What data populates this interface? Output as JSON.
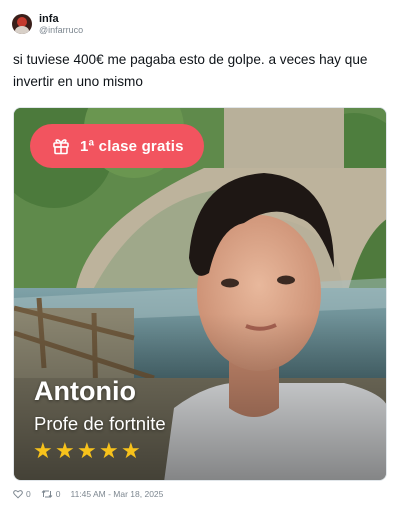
{
  "author": {
    "display_name": "infa",
    "handle": "@infarruco"
  },
  "tweet": {
    "text": "si tuviese 400€ me pagaba esto de golpe. a veces hay que invertir en uno mismo"
  },
  "media": {
    "badge_text": "1ª clase gratis",
    "badge_icon": "gift-icon",
    "tutor_name": "Antonio",
    "tutor_subject": "Profe de fortnite",
    "rating_stars": 5,
    "colors": {
      "badge": "#f2545f",
      "stars": "#f7c21b"
    }
  },
  "footer": {
    "likes": "0",
    "retweets": "0",
    "timestamp": "11:45 AM - Mar 18, 2025"
  }
}
